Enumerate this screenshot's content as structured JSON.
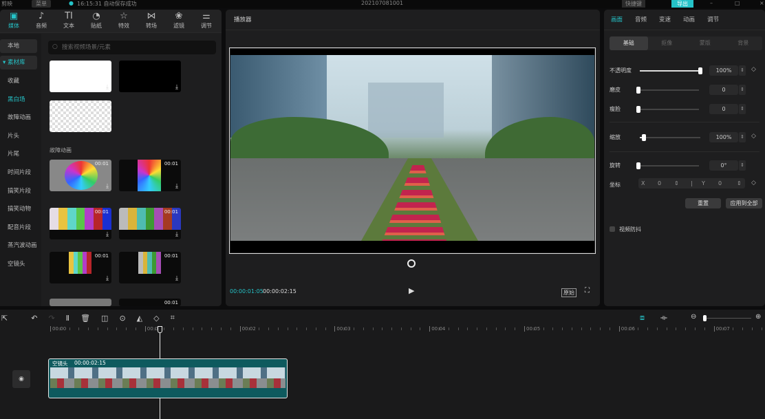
{
  "titlebar": {
    "app": "剪映",
    "menu": "菜单",
    "autosave": "16:15:31 自动保存成功",
    "project": "202107081001",
    "shortcuts": "快捷键",
    "export": "导出"
  },
  "toolbar": [
    {
      "label": "媒体",
      "icon": "media-icon"
    },
    {
      "label": "音频",
      "icon": "audio-icon"
    },
    {
      "label": "文本",
      "icon": "text-icon"
    },
    {
      "label": "贴纸",
      "icon": "sticker-icon"
    },
    {
      "label": "特效",
      "icon": "effects-icon"
    },
    {
      "label": "转场",
      "icon": "transition-icon"
    },
    {
      "label": "滤镜",
      "icon": "filter-icon"
    },
    {
      "label": "调节",
      "icon": "adjust-icon"
    }
  ],
  "sidebar": {
    "local": "本地",
    "library": "素材库",
    "items": [
      "收藏",
      "黑白场",
      "故障动画",
      "片头",
      "片尾",
      "时间片段",
      "搞笑片段",
      "搞笑动物",
      "配音片段",
      "蒸汽波动画",
      "空镜头"
    ],
    "selected": "黑白场"
  },
  "search": {
    "placeholder": "搜索视频场景/元素"
  },
  "media": {
    "section": "故障动画",
    "duration": "00:01"
  },
  "player": {
    "title": "播放器",
    "current": "00:00:01:05",
    "total": "00:00:02:15",
    "ratio": "原始"
  },
  "inspector": {
    "tabs": [
      "画面",
      "音频",
      "变速",
      "动画",
      "调节"
    ],
    "subtabs": [
      "基础",
      "抠像",
      "蒙版",
      "背景"
    ],
    "opacity": {
      "label": "不透明度",
      "value": "100%",
      "level": 1.0
    },
    "smooth": {
      "label": "磨皮",
      "value": "0",
      "level": 0
    },
    "slim": {
      "label": "瘦脸",
      "value": "0",
      "level": 0
    },
    "scale": {
      "label": "缩放",
      "value": "100%",
      "level": 0.07
    },
    "rotate": {
      "label": "旋转",
      "value": "0°",
      "level": 0
    },
    "position": {
      "label": "坐标",
      "x_label": "X",
      "x": "0",
      "y_label": "Y",
      "y": "0"
    },
    "reset": "重置",
    "apply_all": "应用到全部",
    "stabilize": "视频防抖"
  },
  "timeline": {
    "ticks": [
      "00:00",
      "00:01",
      "00:02",
      "00:03",
      "00:04",
      "00:05",
      "00:06",
      "00:07"
    ],
    "clip": {
      "name": "空镜头",
      "duration": "00:00:02:15"
    }
  },
  "colors": {
    "accent": "#25c3c8",
    "clip": "#0e5a5e"
  }
}
